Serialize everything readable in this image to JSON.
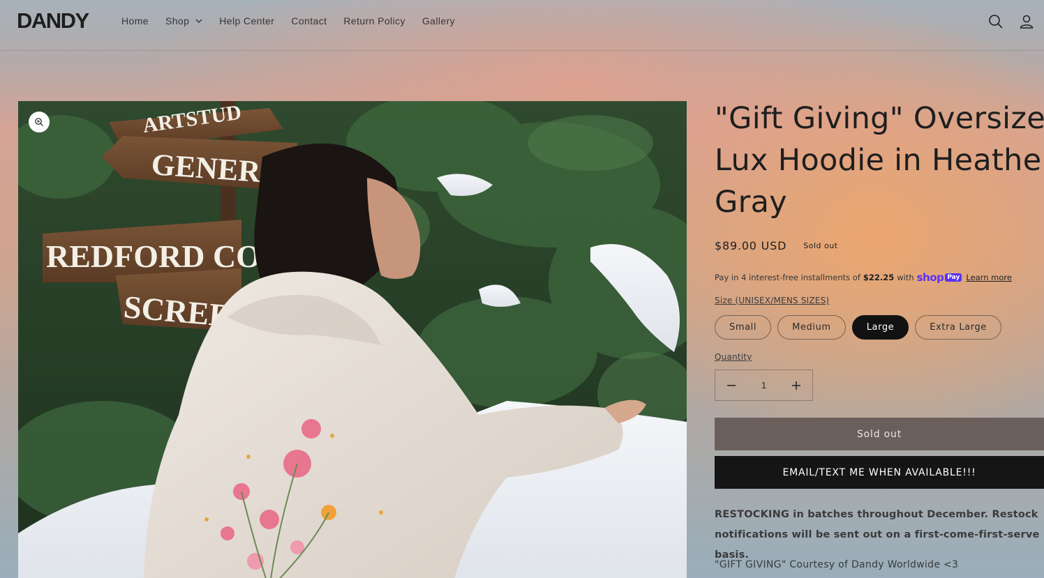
{
  "header": {
    "logo": "DANDY",
    "nav": [
      {
        "label": "Home"
      },
      {
        "label": "Shop",
        "has_dropdown": true
      },
      {
        "label": "Help Center"
      },
      {
        "label": "Contact"
      },
      {
        "label": "Return Policy"
      },
      {
        "label": "Gallery"
      }
    ],
    "icons": [
      "search-icon",
      "account-icon"
    ]
  },
  "media": {
    "zoom_icon": "zoom-icon",
    "sign_texts": [
      "ARTSTUD",
      "GENERAL",
      "REDFORD CON",
      "SCREEN"
    ]
  },
  "product": {
    "title": "\"Gift Giving\" Oversized Lux Hoodie in Heather Gray",
    "title_lines": [
      "\"Gift Giving\" Oversized",
      "Lux Hoodie in Heather",
      "Gray"
    ],
    "price": "$89.00 USD",
    "badge": "Sold out",
    "installments": {
      "prefix": "Pay in 4 interest-free installments of",
      "amount": "$22.25",
      "suffix": "with",
      "shop_logo": "shop",
      "pay_logo": "Pay",
      "learn_more": "Learn more"
    },
    "size_label": "Size (UNISEX/MENS SIZES)",
    "sizes": [
      {
        "label": "Small",
        "selected": false
      },
      {
        "label": "Medium",
        "selected": false
      },
      {
        "label": "Large",
        "selected": true
      },
      {
        "label": "Extra Large",
        "selected": false
      }
    ],
    "quantity_label": "Quantity",
    "quantity": "1",
    "sold_out_button": "Sold out",
    "notify_button": "EMAIL/TEXT ME WHEN AVAILABLE!!!",
    "restock_note": "RESTOCKING in batches throughout December. Restock notifications will be sent out on a first-come-first-serve basis.",
    "courtesy": "\"GIFT GIVING\" Courtesy of Dandy Worldwide <3"
  },
  "colors": {
    "primary_dark": "#121212",
    "sold_out_bg": "#6b5f5c",
    "shop_pay": "#5a31f4"
  }
}
